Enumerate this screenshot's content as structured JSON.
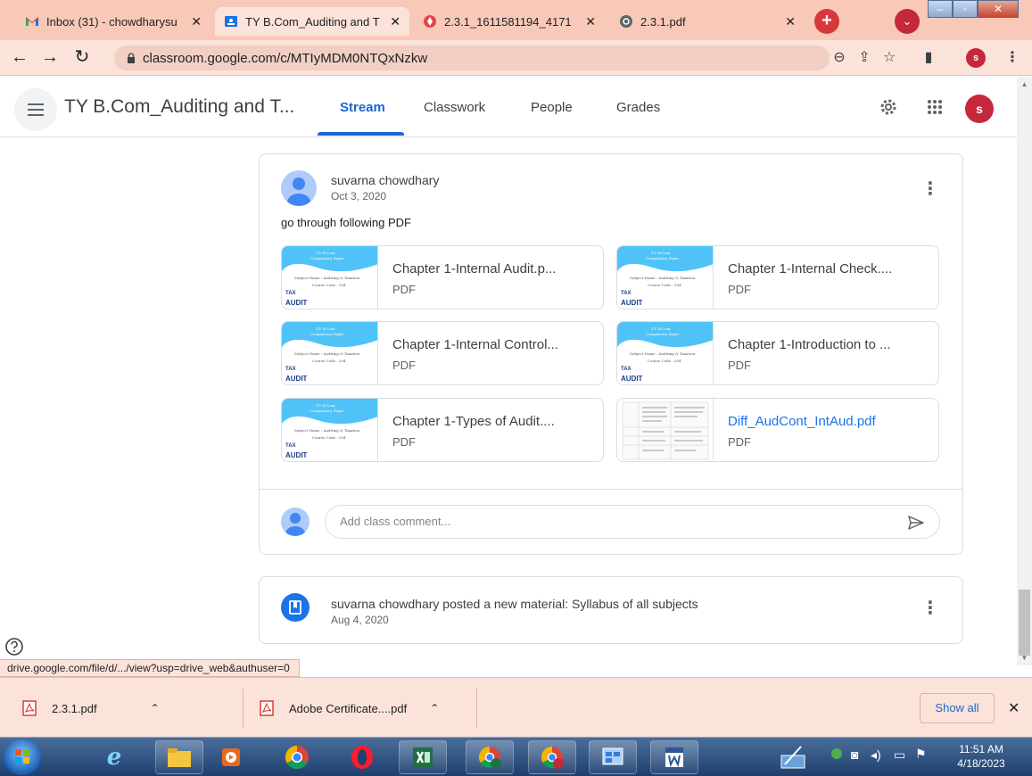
{
  "browser": {
    "tabs": [
      {
        "title": "Inbox (31) - chowdharysu",
        "icon": "gmail-icon"
      },
      {
        "title": "TY B.Com_Auditing and T",
        "icon": "classroom-icon"
      },
      {
        "title": "2.3.1_1611581194_4171",
        "icon": "pdf-tool-icon"
      },
      {
        "title": "2.3.1.pdf",
        "icon": "globe-icon"
      }
    ],
    "new_tab_label": "+",
    "profile_initial": "s",
    "url": "classroom.google.com/c/MTIyMDM0NTQxNzkw"
  },
  "classroom": {
    "class_title": "TY B.Com_Auditing and T...",
    "tabs": [
      "Stream",
      "Classwork",
      "People",
      "Grades"
    ],
    "active_tab": "Stream",
    "user_initial": "s"
  },
  "post": {
    "author": "suvarna chowdhary",
    "date": "Oct 3, 2020",
    "text": "go through following PDF",
    "attachments": [
      {
        "name": "Chapter 1-Internal Audit.p...",
        "type": "PDF"
      },
      {
        "name": "Chapter 1-Internal Check....",
        "type": "PDF"
      },
      {
        "name": "Chapter 1-Internal Control...",
        "type": "PDF"
      },
      {
        "name": "Chapter 1-Introduction to ...",
        "type": "PDF"
      },
      {
        "name": "Chapter 1-Types of Audit....",
        "type": "PDF"
      },
      {
        "name": "Diff_AudCont_IntAud.pdf",
        "type": "PDF"
      }
    ],
    "thumb_text": {
      "line1": "T.Y. B.Com",
      "line2": "Compulsory Paper",
      "subject": "Subject Name : Auditing & Taxation",
      "course": "Course Code : 304",
      "logo_top": "TAX",
      "logo_bottom": "AUDIT"
    },
    "comment_placeholder": "Add class comment..."
  },
  "material": {
    "text": "suvarna chowdhary posted a new material: Syllabus of all subjects",
    "date": "Aug 4, 2020"
  },
  "status_url": "drive.google.com/file/d/.../view?usp=drive_web&authuser=0",
  "downloads": {
    "items": [
      "2.3.1.pdf",
      "Adobe Certificate....pdf"
    ],
    "show_all": "Show all"
  },
  "taskbar": {
    "time": "11:51 AM",
    "date": "4/18/2023"
  },
  "colors": {
    "accent": "#1967d2",
    "tab_strip": "#f8c9b8",
    "profile": "#c5283b"
  }
}
